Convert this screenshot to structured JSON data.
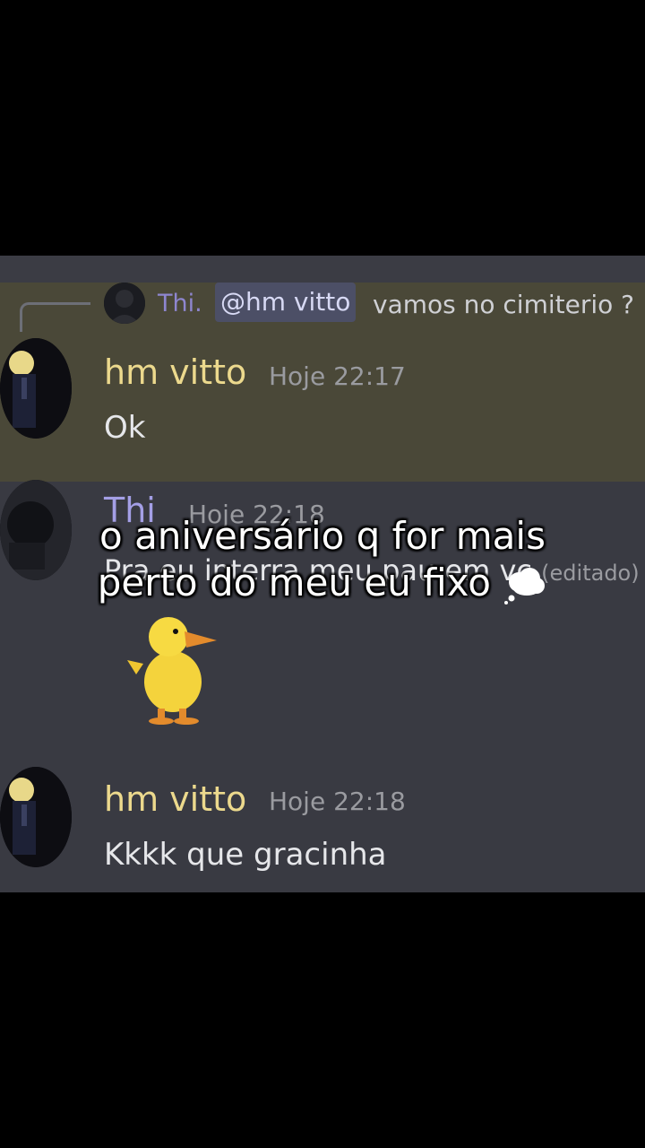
{
  "reply": {
    "author": "Thi.",
    "mention": "@hm vitto",
    "text": "vamos no cimiterio ?"
  },
  "messages": [
    {
      "author": "hm vitto",
      "time": "Hoje 22:17",
      "text": "Ok"
    },
    {
      "author": "Thi",
      "time": "Hoje 22:18",
      "text": "Pra eu interra meu pau em vc",
      "edited": "(editado)",
      "sticker": "duck-sticker"
    },
    {
      "author": "hm vitto",
      "time": "Hoje 22:18",
      "text": "Kkkk que gracinha"
    }
  ],
  "caption": {
    "line1": "o aniversário q for mais",
    "line2": "perto do meu eu fixo",
    "icon": "thought-cloud-icon"
  },
  "colors": {
    "background": "#000000",
    "chat_bg": "#393a42",
    "mention_highlight": "#4a4838",
    "vitto_name": "#ecd98d",
    "thi_name": "#a49fe6"
  }
}
